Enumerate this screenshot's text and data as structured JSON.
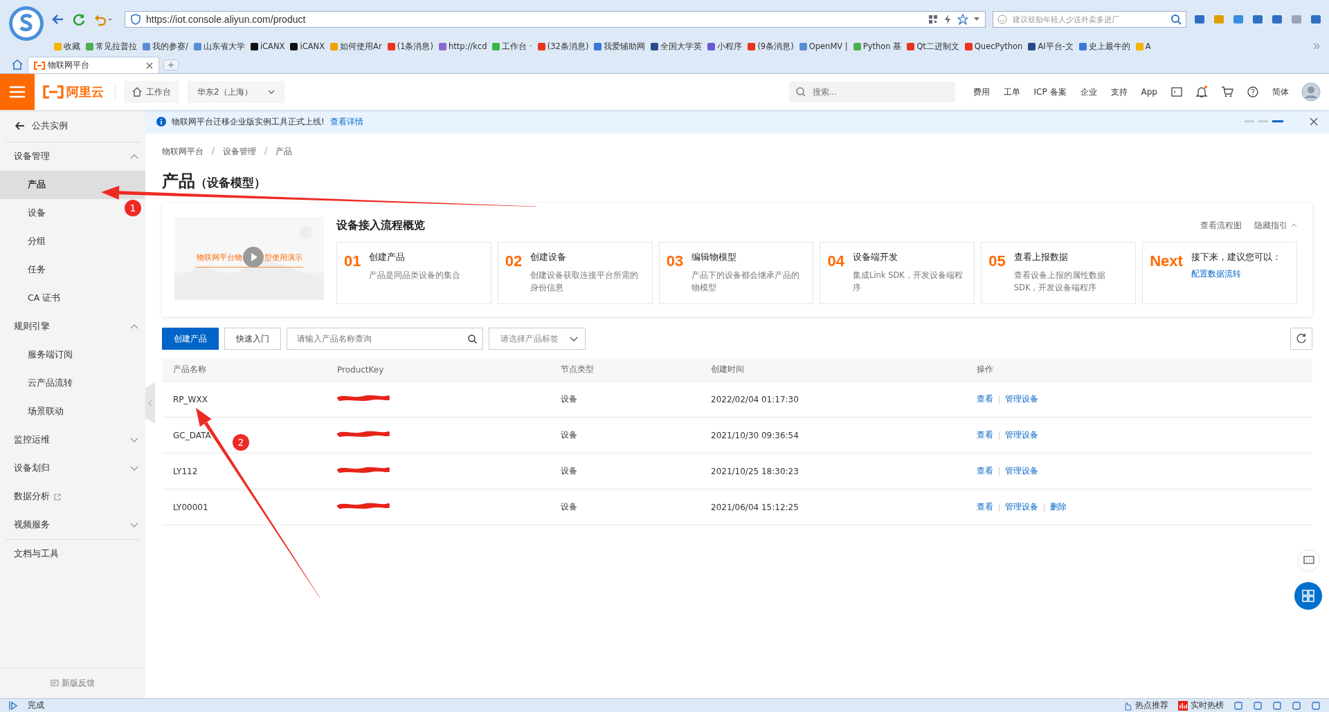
{
  "browser": {
    "url": "https://iot.console.aliyun.com/product",
    "search": {
      "placeholder": "建议鼓励年轻人少送外卖多进厂"
    },
    "bookmarks": [
      {
        "label": "收藏",
        "color": "#f5b400"
      },
      {
        "label": "常见拉普拉",
        "color": "#4caf50"
      },
      {
        "label": "我的参赛/",
        "color": "#5b8dd6"
      },
      {
        "label": "山东省大学",
        "color": "#5b8dd6"
      },
      {
        "label": "iCANX",
        "color": "#111111"
      },
      {
        "label": "iCANX",
        "color": "#111111"
      },
      {
        "label": "如何使用Ar",
        "color": "#f5a000"
      },
      {
        "label": "(1条消息)",
        "color": "#e8341c"
      },
      {
        "label": "http://kcd",
        "color": "#8a6bd1"
      },
      {
        "label": "工作台 ·",
        "color": "#3cb34a"
      },
      {
        "label": "(32条消息)",
        "color": "#e8341c"
      },
      {
        "label": "我爱辅助网",
        "color": "#3a78d6"
      },
      {
        "label": "全国大学英",
        "color": "#2b4a8c"
      },
      {
        "label": "小程序",
        "color": "#6a5acd"
      },
      {
        "label": "(9条消息)",
        "color": "#e8341c"
      },
      {
        "label": "OpenMV |",
        "color": "#5b8dd6"
      },
      {
        "label": "Python 基",
        "color": "#4caf50"
      },
      {
        "label": "Qt二进制文",
        "color": "#e8341c"
      },
      {
        "label": "QuecPython",
        "color": "#e8341c"
      },
      {
        "label": "AI平台-文",
        "color": "#2b4a8c"
      },
      {
        "label": "史上最牛的",
        "color": "#3a78d6"
      },
      {
        "label": "A",
        "color": "#f5b400"
      }
    ],
    "tabs": [
      {
        "title": "物联网平台",
        "selected": true
      }
    ]
  },
  "header": {
    "logo": "阿里云",
    "workbench": "工作台",
    "region": "华东2（上海）",
    "search": {
      "placeholder": "搜索..."
    },
    "nav": [
      "费用",
      "工单",
      "ICP 备案",
      "企业",
      "支持",
      "App"
    ],
    "language": "简体"
  },
  "sidebar": {
    "back": "公共实例",
    "items": [
      {
        "label": "设备管理",
        "kind": "group",
        "expanded": true,
        "children": [
          {
            "label": "产品",
            "selected": true
          },
          {
            "label": "设备",
            "selected": false
          },
          {
            "label": "分组",
            "selected": false
          },
          {
            "label": "任务",
            "selected": false
          },
          {
            "label": "CA 证书",
            "selected": false
          }
        ]
      },
      {
        "label": "规则引擎",
        "kind": "group",
        "expanded": true,
        "children": [
          {
            "label": "服务端订阅",
            "selected": false
          },
          {
            "label": "云产品流转",
            "selected": false
          },
          {
            "label": "场景联动",
            "selected": false
          }
        ]
      },
      {
        "label": "监控运维",
        "kind": "group",
        "expanded": false
      },
      {
        "label": "设备划归",
        "kind": "group",
        "expanded": false
      },
      {
        "label": "数据分析",
        "kind": "external"
      },
      {
        "label": "视频服务",
        "kind": "group",
        "expanded": false
      }
    ],
    "footer": "文档与工具",
    "feedback": "新版反馈"
  },
  "banner": {
    "text": "物联网平台迁移企业版实例工具正式上线!",
    "link": "查看详情"
  },
  "breadcrumb": {
    "items": [
      "物联网平台",
      "设备管理",
      "产品"
    ],
    "separator": "/"
  },
  "page_title": {
    "title": "产品",
    "subtitle": "（设备模型）"
  },
  "guide": {
    "title": "设备接入流程概览",
    "links": [
      "查看流程图",
      "隐藏指引"
    ],
    "video": {
      "kind": "picture",
      "caption_before": "物联网平台物",
      "caption_after": "型使用演示"
    },
    "steps": [
      {
        "number": "01",
        "title": "创建产品",
        "description": "产品是同品类设备的集合"
      },
      {
        "number": "02",
        "title": "创建设备",
        "description": "创建设备获取连接平台所需的身份信息"
      },
      {
        "number": "03",
        "title": "编辑物模型",
        "description": "产品下的设备都会继承产品的物模型"
      },
      {
        "number": "04",
        "title": "设备端开发",
        "description": "集成Link SDK，开发设备端程序"
      },
      {
        "number": "05",
        "title": "查看上报数据",
        "description": "查看设备上报的属性数据 SDK，开发设备端程序"
      }
    ],
    "next": {
      "number": "Next",
      "title": "接下来，建议您可以：",
      "link": "配置数据流转"
    }
  },
  "toolbar": {
    "create": "创建产品",
    "quick_start": "快速入门",
    "search": {
      "placeholder": "请输入产品名称查询"
    },
    "tag_select": {
      "placeholder": "请选择产品标签"
    }
  },
  "table": {
    "columns": [
      "产品名称",
      "ProductKey",
      "节点类型",
      "创建时间",
      "操作"
    ],
    "rows": [
      {
        "name": "RP_WXX",
        "key_redacted": true,
        "node_type": "设备",
        "created": "2022/02/04 01:17:30",
        "actions": [
          "查看",
          "管理设备"
        ]
      },
      {
        "name": "GC_DATA",
        "key_redacted": true,
        "node_type": "设备",
        "created": "2021/10/30 09:36:54",
        "actions": [
          "查看",
          "管理设备"
        ]
      },
      {
        "name": "LY112",
        "key_redacted": true,
        "node_type": "设备",
        "created": "2021/10/25 18:30:23",
        "actions": [
          "查看",
          "管理设备"
        ]
      },
      {
        "name": "LY00001",
        "key_redacted": true,
        "node_type": "设备",
        "created": "2021/06/04 15:12:25",
        "actions": [
          "查看",
          "管理设备",
          "删除"
        ]
      }
    ]
  },
  "annotations": [
    {
      "number": "1"
    },
    {
      "number": "2"
    }
  ],
  "status_bar": {
    "status": "完成",
    "items": [
      "热点推荐",
      "实时热榜"
    ]
  }
}
